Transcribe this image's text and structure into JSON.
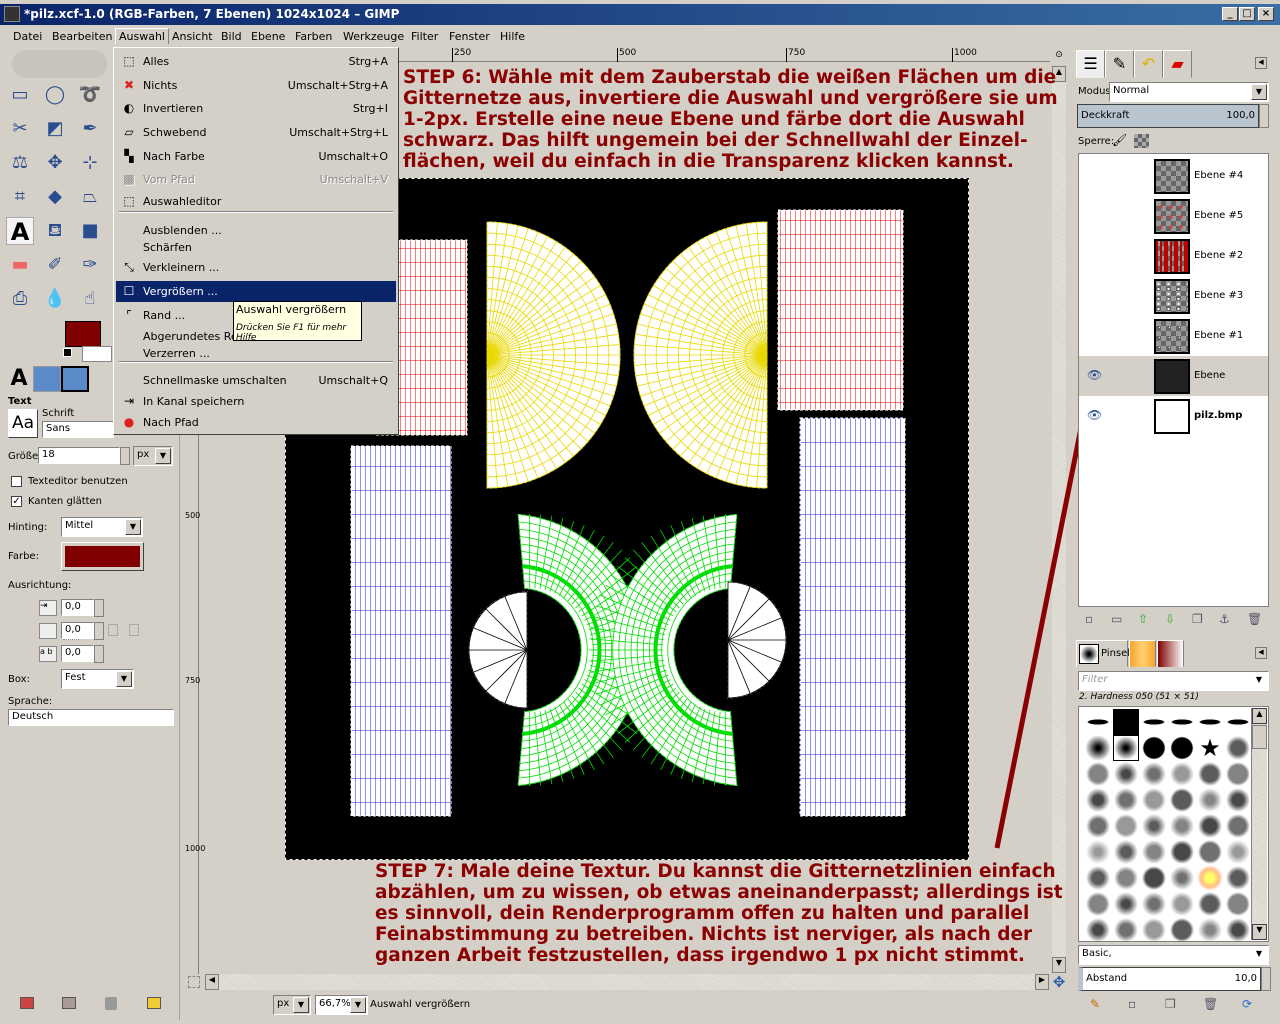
{
  "window": {
    "title": "*pilz.xcf-1.0 (RGB-Farben, 7 Ebenen) 1024x1024 – GIMP",
    "buttons": [
      "_",
      "□",
      "×"
    ]
  },
  "menubar": [
    "Datei",
    "Bearbeiten",
    "Auswahl",
    "Ansicht",
    "Bild",
    "Ebene",
    "Farben",
    "Werkzeuge",
    "Filter",
    "Fenster",
    "Hilfe"
  ],
  "menu": {
    "items": [
      {
        "label": "Alles",
        "shortcut": "Strg+A",
        "icon": "select-all-icon"
      },
      {
        "label": "Nichts",
        "shortcut": "Umschalt+Strg+A",
        "icon": "select-none-icon"
      },
      {
        "label": "Invertieren",
        "shortcut": "Strg+I",
        "icon": "invert-icon"
      },
      {
        "label": "Schwebend",
        "shortcut": "Umschalt+Strg+L",
        "icon": "float-icon"
      },
      {
        "label": "Nach Farbe",
        "shortcut": "Umschalt+O",
        "icon": "by-color-icon"
      },
      {
        "label": "Vom Pfad",
        "shortcut": "Umschalt+V",
        "icon": "from-path-icon",
        "disabled": true
      },
      {
        "label": "Auswahleditor",
        "shortcut": "",
        "icon": "selection-editor-icon"
      },
      {
        "label": "Ausblenden ...",
        "shortcut": ""
      },
      {
        "label": "Schärfen",
        "shortcut": ""
      },
      {
        "label": "Verkleinern ...",
        "shortcut": "",
        "icon": "shrink-icon"
      },
      {
        "label": "Vergrößern ...",
        "shortcut": "",
        "icon": "grow-icon",
        "highlighted": true
      },
      {
        "label": "Rand ...",
        "shortcut": "",
        "icon": "border-icon"
      },
      {
        "label": "Abgerundetes Rechteck ...",
        "shortcut": ""
      },
      {
        "label": "Verzerren ...",
        "shortcut": ""
      },
      {
        "label": "Schnellmaske umschalten",
        "shortcut": "Umschalt+Q"
      },
      {
        "label": "In Kanal speichern",
        "shortcut": "",
        "icon": "save-channel-icon"
      },
      {
        "label": "Nach Pfad",
        "shortcut": "",
        "icon": "to-path-icon"
      }
    ]
  },
  "tooltip": {
    "title": "Auswahl vergrößern",
    "hint": "Drücken Sie F1 für mehr Hilfe"
  },
  "toolbox": {
    "tools": [
      "rect-select",
      "ellipse-select",
      "free-select",
      "scissors",
      "foreground-select",
      "paths",
      "measure",
      "move",
      "align",
      "crop",
      "rotate",
      "perspective",
      "text",
      "bucket-fill",
      "blend",
      "eraser",
      "airbrush",
      "ink",
      "clone",
      "smudge",
      "dodge"
    ],
    "fg_color": "#800000",
    "bg_color": "#ffffff",
    "options": {
      "title": "Text",
      "font_label": "Schrift",
      "font_preview": "Aa",
      "font": "Sans",
      "size_label": "Größe:",
      "size": "18",
      "unit": "px",
      "use_editor": "Texteditor benutzen",
      "use_editor_checked": false,
      "antialias": "Kanten glätten",
      "antialias_checked": true,
      "hinting_label": "Hinting:",
      "hinting": "Mittel",
      "color_label": "Farbe:",
      "color": "#800000",
      "justify_label": "Ausrichtung:",
      "indent": "0,0",
      "line_spacing": "0,0",
      "letter_spacing": "0,0",
      "box_label": "Box:",
      "box": "Fest",
      "language_label": "Sprache:",
      "language": "Deutsch"
    }
  },
  "rulers": {
    "top": [
      "250",
      "500",
      "750",
      "1000"
    ],
    "left": [
      "500",
      "750",
      "1000"
    ]
  },
  "annotations": {
    "step6": "STEP 6: Wähle mit dem Zauberstab die weißen Flächen um die\nGitternetze aus, invertiere die Auswahl und vergrößere sie um\n1-2px. Erstelle eine neue Ebene und färbe dort die Auswahl\nschwarz. Das hilft ungemein bei der Schnellwahl der Einzel-\nflächen, weil du einfach in die Transparenz klicken kannst.",
    "step7": "STEP 7: Male deine Textur. Du kannst die Gitternetzlinien einfach\nabzählen, um zu wissen, ob etwas aneinanderpasst; allerdings ist\nes sinnvoll, dein Renderprogramm offen zu halten und parallel\nFeinabstimmung zu betreiben. Nichts ist nerviger, als nach der\nganzen Arbeit festzustellen, dass irgendwo 1 px nicht stimmt.",
    "color": "#8b0000"
  },
  "statusbar": {
    "unit": "px",
    "zoom": "66,7%",
    "message": "Auswahl vergrößern"
  },
  "layers": {
    "mode_label": "Modus:",
    "mode": "Normal",
    "opacity_label": "Deckkraft",
    "opacity": "100,0",
    "lock_label": "Sperre:",
    "items": [
      {
        "name": "Ebene #4",
        "visible": false
      },
      {
        "name": "Ebene #5",
        "visible": false
      },
      {
        "name": "Ebene #2",
        "visible": false
      },
      {
        "name": "Ebene #3",
        "visible": false
      },
      {
        "name": "Ebene #1",
        "visible": false
      },
      {
        "name": "Ebene",
        "visible": true,
        "selected": true
      },
      {
        "name": "pilz.bmp",
        "visible": true,
        "bold": true
      }
    ]
  },
  "brushes": {
    "tab": "Pinsel",
    "filter_placeholder": "Filter",
    "selected": "2. Hardness 050 (51 × 51)",
    "set": "Basic,",
    "spacing_label": "Abstand",
    "spacing": "10,0"
  }
}
